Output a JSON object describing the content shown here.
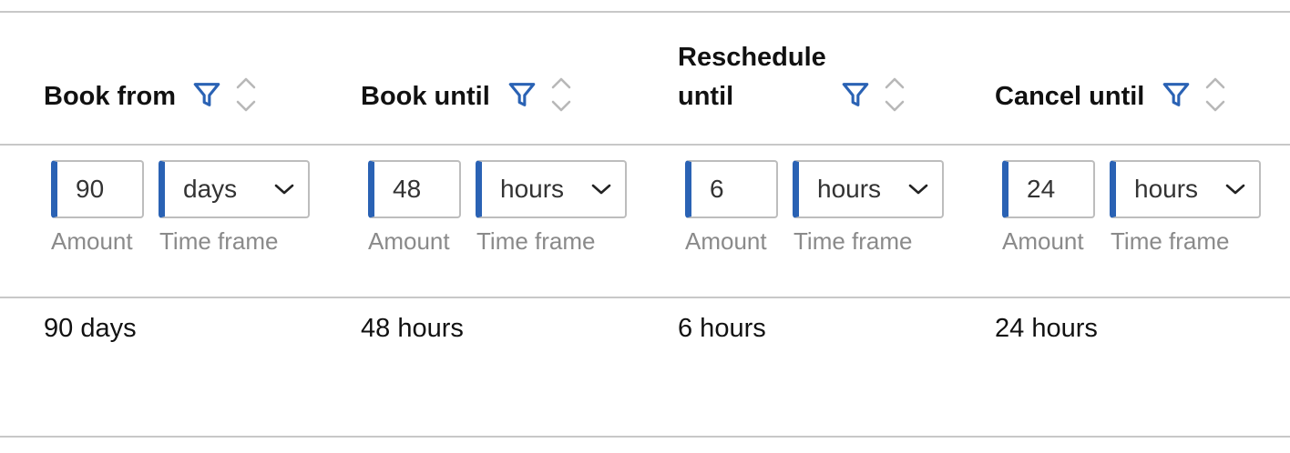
{
  "columns": [
    {
      "title": "Book from",
      "amount": "90",
      "timeframe": "days",
      "amount_caption": "Amount",
      "timeframe_caption": "Time frame",
      "value": "90 days"
    },
    {
      "title": "Book until",
      "amount": "48",
      "timeframe": "hours",
      "amount_caption": "Amount",
      "timeframe_caption": "Time frame",
      "value": "48 hours"
    },
    {
      "title": "Reschedule until",
      "amount": "6",
      "timeframe": "hours",
      "amount_caption": "Amount",
      "timeframe_caption": "Time frame",
      "value": "6 hours"
    },
    {
      "title": "Cancel until",
      "amount": "24",
      "timeframe": "hours",
      "amount_caption": "Amount",
      "timeframe_caption": "Time frame",
      "value": "24 hours"
    }
  ],
  "icons": {
    "filter": "filter-icon",
    "sort": "sort-icon",
    "dropdown": "chevron-down-icon"
  },
  "colors": {
    "accent": "#2a62b4",
    "border": "#bdbdbd",
    "divider": "#c8c8c8",
    "caption": "#8a8a8a",
    "sort_icon": "#b8b8b8"
  }
}
